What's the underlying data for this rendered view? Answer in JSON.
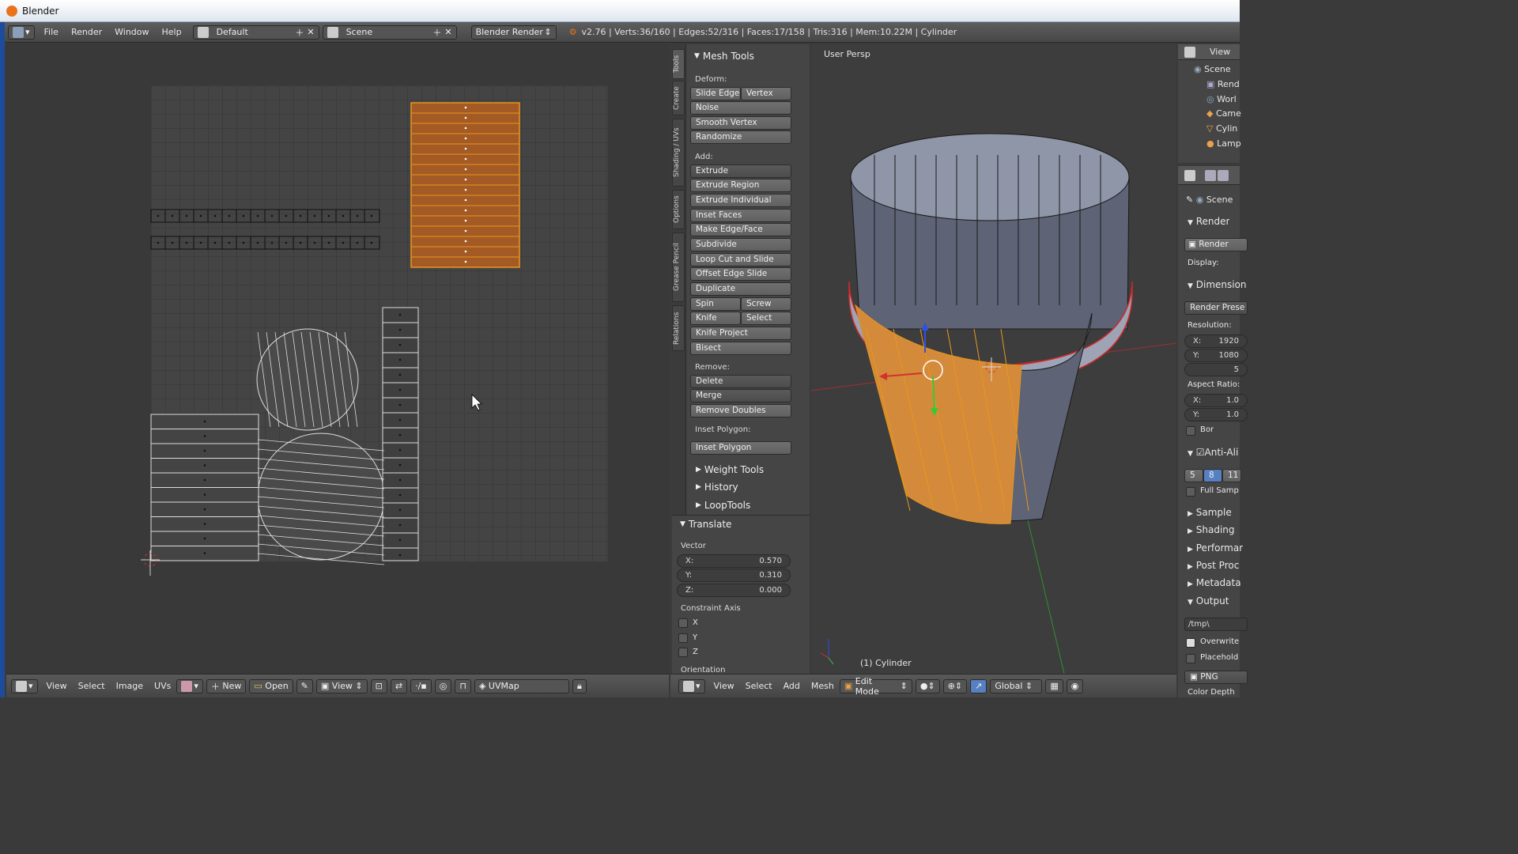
{
  "app": {
    "title": "Blender"
  },
  "menubar": {
    "items": [
      "File",
      "Render",
      "Window",
      "Help"
    ],
    "layout": "Default",
    "scene": "Scene",
    "engine": "Blender Render",
    "stats": "v2.76 | Verts:36/160 | Edges:52/316 | Faces:17/158 | Tris:316 | Mem:10.22M | Cylinder"
  },
  "tool_tabs": [
    "Tools",
    "Create",
    "Shading / UVs",
    "Options",
    "Grease Pencil",
    "Relations"
  ],
  "mesh_tools": {
    "title": "Mesh Tools",
    "deform_label": "Deform:",
    "slide_edge": "Slide Edge",
    "vertex": "Vertex",
    "noise": "Noise",
    "smooth_vertex": "Smooth Vertex",
    "randomize": "Randomize",
    "add_label": "Add:",
    "extrude": "Extrude",
    "extrude_region": "Extrude Region",
    "extrude_individual": "Extrude Individual",
    "inset_faces": "Inset Faces",
    "make_edge_face": "Make Edge/Face",
    "subdivide": "Subdivide",
    "loop_cut": "Loop Cut and Slide",
    "offset_edge": "Offset Edge Slide",
    "duplicate": "Duplicate",
    "spin": "Spin",
    "screw": "Screw",
    "knife": "Knife",
    "select": "Select",
    "knife_project": "Knife Project",
    "bisect": "Bisect",
    "remove_label": "Remove:",
    "delete": "Delete",
    "merge": "Merge",
    "remove_doubles": "Remove Doubles",
    "inset_polygon_label": "Inset Polygon:",
    "inset_polygon": "Inset Polygon"
  },
  "collapsed_panels": [
    "Weight Tools",
    "History",
    "LoopTools"
  ],
  "translate": {
    "title": "Translate",
    "vector_label": "Vector",
    "x_label": "X:",
    "x": "0.570",
    "y_label": "Y:",
    "y": "0.310",
    "z_label": "Z:",
    "z": "0.000",
    "constraint_label": "Constraint Axis",
    "cx": "X",
    "cy": "Y",
    "cz": "Z",
    "orientation_label": "Orientation"
  },
  "viewport": {
    "label": "User Persp",
    "object": "(1) Cylinder"
  },
  "outliner": {
    "view": "View",
    "items": [
      "Scene",
      "Rend",
      "Worl",
      "Came",
      "Cylin",
      "Lamp"
    ]
  },
  "properties": {
    "scene": "Scene",
    "render_title": "Render",
    "render_btn": "Render",
    "display": "Display:",
    "dimensions": "Dimension",
    "render_presets": "Render Prese",
    "resolution": "Resolution:",
    "res_x_label": "X:",
    "res_x": "1920",
    "res_y_label": "Y:",
    "res_y": "1080",
    "res_pct": "5",
    "aspect": "Aspect Ratio:",
    "asp_x_label": "X:",
    "asp_x": "1.0",
    "asp_y_label": "Y:",
    "asp_y": "1.0",
    "border": "Bor",
    "anti_alias": "Anti-Ali",
    "aa_values": [
      "5",
      "8",
      "11"
    ],
    "full_sample": "Full Samp",
    "sampled": "Sample",
    "shading": "Shading",
    "performance": "Performar",
    "post_processing": "Post Proc",
    "metadata": "Metadata",
    "output": "Output",
    "output_path": "/tmp\\",
    "overwrite": "Overwrite",
    "placeholder": "Placehold",
    "format": "PNG",
    "color_depth": "Color Depth"
  },
  "uv_bottom": {
    "view": "View",
    "select": "Select",
    "image": "Image",
    "uvs": "UVs",
    "new": "New",
    "open": "Open",
    "view2": "View",
    "uvmap": "UVMap"
  },
  "view3d_bottom": {
    "view": "View",
    "select": "Select",
    "add": "Add",
    "mesh": "Mesh",
    "mode": "Edit Mode",
    "orientation": "Global"
  },
  "colors": {
    "selected": "#e8961e",
    "uv_selected": "#c87d3e",
    "axis_x": "#d43030",
    "axis_y": "#39c839",
    "axis_z": "#3050e0"
  }
}
